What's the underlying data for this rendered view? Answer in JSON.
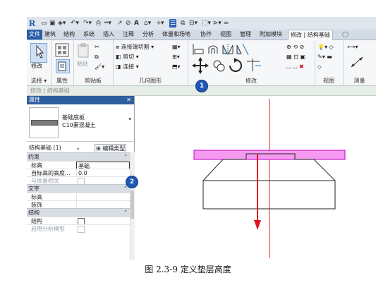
{
  "app": {
    "logo": "R"
  },
  "quick_access": [
    "open-icon",
    "save-icon",
    "sync-icon",
    "undo-icon",
    "redo-icon",
    "print-icon",
    "measure-icon",
    "dimension-icon",
    "tag-icon",
    "text-icon",
    "view3d-icon",
    "section-icon",
    "thin-lines-icon",
    "close-views-icon",
    "switch-windows-icon",
    "customize-icon"
  ],
  "tabs": {
    "file": "文件",
    "items": [
      "建筑",
      "结构",
      "系统",
      "插入",
      "注释",
      "分析",
      "体量和场地",
      "协作",
      "视图",
      "管理",
      "附加模块"
    ],
    "contextual": "修改 | 结构基础"
  },
  "ribbon": {
    "modify_label": "修改",
    "select_label": "选择 ▾",
    "properties_label": "属性",
    "paste_label": "粘贴",
    "clipboard_label": "剪贴板",
    "cut_label": "剪切",
    "join_label": "连接",
    "cut_join_geometry": "连接端切割",
    "geometry_label": "几何图形",
    "modify_panel_label": "修改",
    "view_label": "视图",
    "measure_label": "测量"
  },
  "context_bar": {
    "text": "修改 | 结构基础"
  },
  "properties": {
    "title": "属性",
    "close": "✕",
    "family": "基础底板",
    "type": "C10素混凝土",
    "selector": "结构基础 (1)",
    "edit_type": "编辑类型",
    "groups": [
      {
        "name": "约束",
        "rows": [
          {
            "key": "标高",
            "value": "基础",
            "kind": "text"
          },
          {
            "key": "自标高的高度...",
            "value": "0.0",
            "kind": "text"
          },
          {
            "key": "与体量相关",
            "value": "",
            "kind": "checkbox-disabled"
          }
        ]
      },
      {
        "name": "文字",
        "rows": [
          {
            "key": "标高",
            "value": "",
            "kind": "text"
          },
          {
            "key": "装饰",
            "value": "",
            "kind": "text"
          }
        ]
      },
      {
        "name": "结构",
        "rows": [
          {
            "key": "结构",
            "value": "",
            "kind": "checkbox"
          },
          {
            "key": "启用分析模型",
            "value": "",
            "kind": "checkbox-disabled"
          }
        ]
      }
    ]
  },
  "badges": {
    "one": "1",
    "two": "2"
  },
  "colors": {
    "pad_fill": "#f59af0",
    "pad_stroke": "#c000c0",
    "axis": "#e02020",
    "arrow": "#e0141e",
    "badge": "#1f57b3"
  },
  "caption": "图 2.3-9  定义垫层高度"
}
